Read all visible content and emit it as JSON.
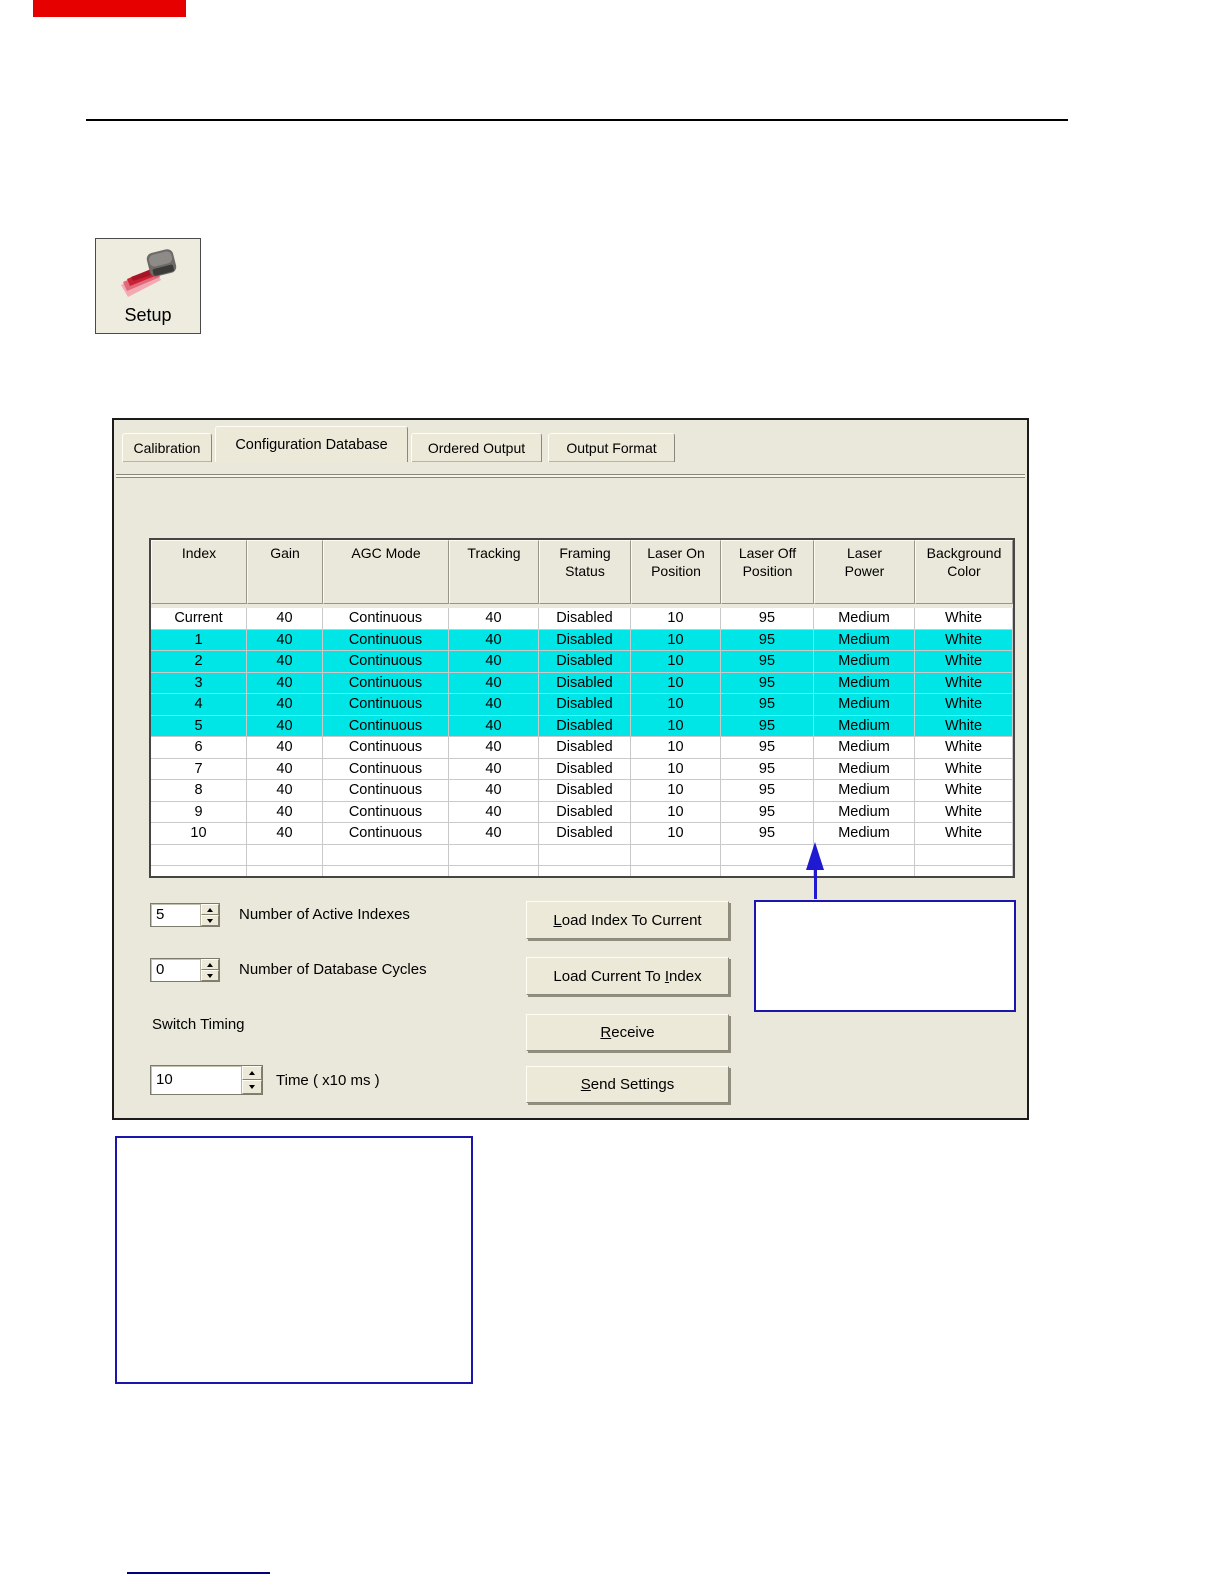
{
  "setup_tool": {
    "label": "Setup"
  },
  "tabs": [
    {
      "label": "Calibration"
    },
    {
      "label": "Configuration Database"
    },
    {
      "label": "Ordered Output"
    },
    {
      "label": "Output Format"
    }
  ],
  "table": {
    "columns": [
      {
        "label": "Index"
      },
      {
        "label": "Gain"
      },
      {
        "label": "AGC Mode"
      },
      {
        "label": "Tracking"
      },
      {
        "label": "Framing\nStatus"
      },
      {
        "label": "Laser On\nPosition"
      },
      {
        "label": "Laser Off\nPosition"
      },
      {
        "label": "Laser\nPower"
      },
      {
        "label": "Background\nColor"
      }
    ],
    "rows": [
      {
        "index": "Current",
        "highlighted": false,
        "values": [
          "40",
          "Continuous",
          "40",
          "Disabled",
          "10",
          "95",
          "Medium",
          "White"
        ]
      },
      {
        "index": "1",
        "highlighted": true,
        "values": [
          "40",
          "Continuous",
          "40",
          "Disabled",
          "10",
          "95",
          "Medium",
          "White"
        ]
      },
      {
        "index": "2",
        "highlighted": true,
        "values": [
          "40",
          "Continuous",
          "40",
          "Disabled",
          "10",
          "95",
          "Medium",
          "White"
        ]
      },
      {
        "index": "3",
        "highlighted": true,
        "values": [
          "40",
          "Continuous",
          "40",
          "Disabled",
          "10",
          "95",
          "Medium",
          "White"
        ]
      },
      {
        "index": "4",
        "highlighted": true,
        "values": [
          "40",
          "Continuous",
          "40",
          "Disabled",
          "10",
          "95",
          "Medium",
          "White"
        ]
      },
      {
        "index": "5",
        "highlighted": true,
        "values": [
          "40",
          "Continuous",
          "40",
          "Disabled",
          "10",
          "95",
          "Medium",
          "White"
        ]
      },
      {
        "index": "6",
        "highlighted": false,
        "values": [
          "40",
          "Continuous",
          "40",
          "Disabled",
          "10",
          "95",
          "Medium",
          "White"
        ]
      },
      {
        "index": "7",
        "highlighted": false,
        "values": [
          "40",
          "Continuous",
          "40",
          "Disabled",
          "10",
          "95",
          "Medium",
          "White"
        ]
      },
      {
        "index": "8",
        "highlighted": false,
        "values": [
          "40",
          "Continuous",
          "40",
          "Disabled",
          "10",
          "95",
          "Medium",
          "White"
        ]
      },
      {
        "index": "9",
        "highlighted": false,
        "values": [
          "40",
          "Continuous",
          "40",
          "Disabled",
          "10",
          "95",
          "Medium",
          "White"
        ]
      },
      {
        "index": "10",
        "highlighted": false,
        "values": [
          "40",
          "Continuous",
          "40",
          "Disabled",
          "10",
          "95",
          "Medium",
          "White"
        ]
      }
    ],
    "empty_row_count": 2
  },
  "fields": {
    "active_indexes": {
      "value": "5",
      "label": "Number of Active Indexes"
    },
    "database_cycles": {
      "value": "0",
      "label": "Number of Database Cycles"
    },
    "switch_timing": {
      "label": "Switch Timing"
    },
    "time": {
      "value": "10",
      "label": "Time ( x10 ms )"
    }
  },
  "buttons": [
    {
      "pre": "",
      "u": "L",
      "post": "oad Index To Current"
    },
    {
      "pre": "Load Current To ",
      "u": "I",
      "post": "ndex"
    },
    {
      "pre": "",
      "u": "R",
      "post": "eceive"
    },
    {
      "pre": "",
      "u": "S",
      "post": "end Settings"
    }
  ],
  "colors": {
    "highlight_cyan": "#00e5e5",
    "panel_bg": "#e9e8da",
    "annotation_navy": "#1a16ad",
    "arrow_blue": "#1f1ad2",
    "marker_red": "#e60000",
    "link_line_navy": "#00007b"
  }
}
